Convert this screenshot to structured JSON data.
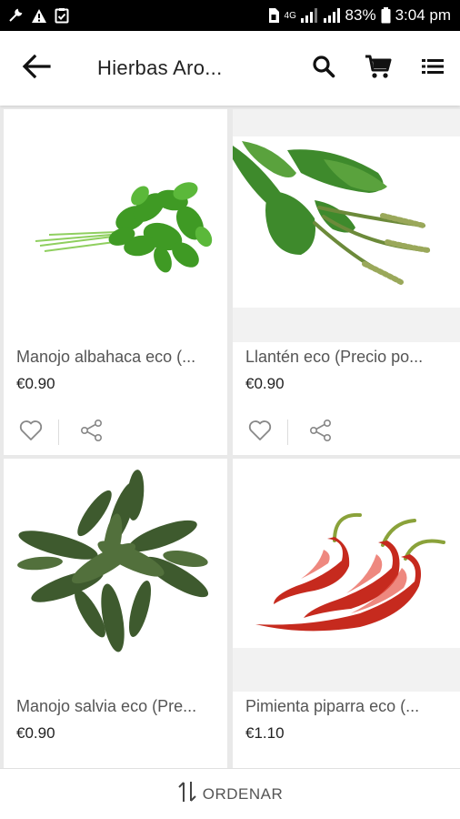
{
  "status_bar": {
    "battery_percent": "83%",
    "time": "3:04 pm",
    "network_label": "4G"
  },
  "app_bar": {
    "title": "Hierbas Aro...",
    "back_icon": "arrow-left-icon",
    "search_icon": "search-icon",
    "cart_icon": "cart-icon",
    "menu_icon": "list-menu-icon"
  },
  "products": [
    {
      "name": "Manojo albahaca eco (...",
      "price": "€0.90",
      "image": "basil-bunch"
    },
    {
      "name": "Llantén eco (Precio po...",
      "price": "€0.90",
      "image": "plantain-leaves"
    },
    {
      "name": "Manojo salvia eco (Pre...",
      "price": "€0.90",
      "image": "sage-bunch"
    },
    {
      "name": "Pimienta piparra eco (...",
      "price": "€1.10",
      "image": "red-chili-peppers"
    }
  ],
  "bottom_bar": {
    "sort_label": "ORDENAR",
    "sort_icon": "sort-arrows-icon"
  },
  "colors": {
    "status_bar_bg": "#000000",
    "app_bar_bg": "#ffffff",
    "grid_bg": "#e9e9e9",
    "text_primary": "#222222",
    "text_secondary": "#555555"
  }
}
